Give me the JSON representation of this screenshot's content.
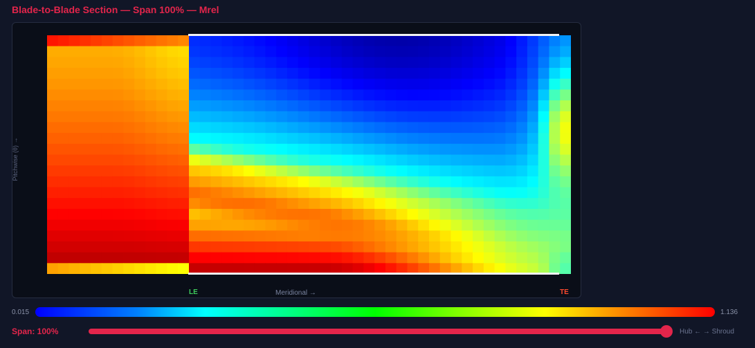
{
  "title": "Blade-to-Blade Section — Span 100% — Mrel",
  "axes": {
    "y_label": "Pitchwise (θ) →",
    "x_label": "Meridional →",
    "le_label": "LE",
    "te_label": "TE"
  },
  "colorbar": {
    "min_label": "0.015",
    "max_label": "1.136",
    "min": 0.015,
    "max": 1.136,
    "colormap": "jet"
  },
  "span": {
    "label": "Span: 100%",
    "value_percent": 100,
    "hint": "Hub ← → Shroud"
  },
  "colors": {
    "accent": "#e3254b",
    "background": "#111627",
    "panel": "#0a0e18",
    "le": "#3ecb5c",
    "te": "#ff4a2e"
  }
}
